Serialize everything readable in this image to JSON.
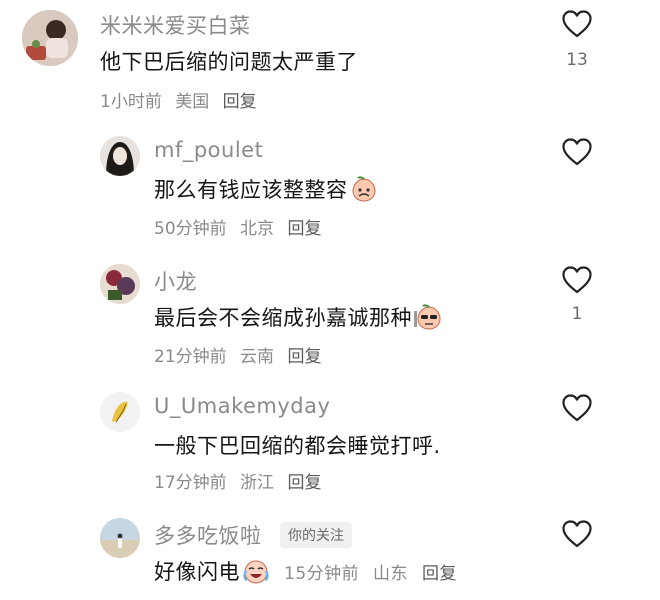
{
  "comments": [
    {
      "username": "米米米爱买白菜",
      "text": "他下巴后缩的问题太严重了",
      "time": "1小时前",
      "location": "美国",
      "reply": "回复",
      "likes": "13"
    },
    {
      "username": "mf_poulet",
      "text": "那么有钱应该整整容",
      "emoji": "peach-face-emoji",
      "time": "50分钟前",
      "location": "北京",
      "reply": "回复",
      "likes": ""
    },
    {
      "username": "小龙",
      "text": "最后会不会缩成孙嘉诚那种",
      "emoji": "peach-face-sunglasses-emoji",
      "time": "21分钟前",
      "location": "云南",
      "reply": "回复",
      "likes": "1"
    },
    {
      "username": "U_Umakemyday",
      "text": "一般下巴回缩的都会睡觉打呼.",
      "time": "17分钟前",
      "location": "浙江",
      "reply": "回复",
      "likes": ""
    },
    {
      "username": "多多吃饭啦",
      "badge": "你的关注",
      "text": "好像闪电",
      "emoji": "crying-laughing-emoji",
      "time": "15分钟前",
      "location": "山东",
      "reply": "回复",
      "likes": ""
    }
  ],
  "icons": {
    "like": "heart-outline-icon"
  },
  "colors": {
    "username": "#8a8a8a",
    "text": "#161616",
    "meta": "#8a8a8a"
  }
}
